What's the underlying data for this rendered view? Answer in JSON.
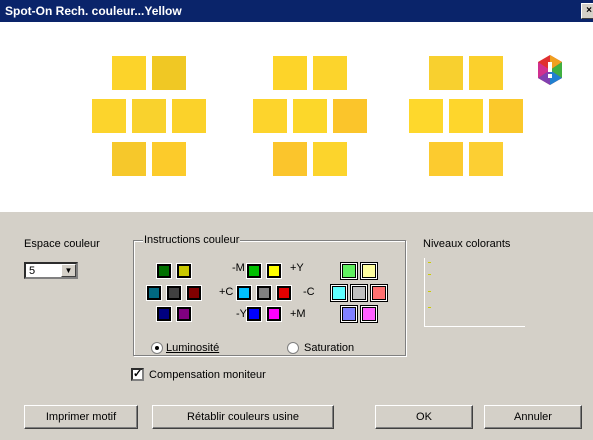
{
  "window": {
    "title": "Spot-On Rech. couleur...Yellow",
    "close_glyph": "×"
  },
  "preview": {
    "groups": [
      [
        "#fcd32a",
        "#f0c824",
        "#fcd42c",
        "#f9d22d",
        "#fbd22a",
        "#f6c82b",
        "#fccb2b",
        "#fcd534"
      ],
      [
        "#fdd429",
        "#fcd42c",
        "#fdd42c",
        "#fcd72a",
        "#fbc52b",
        "#fbc52c",
        "#fcd42c",
        "#fdcc29"
      ],
      [
        "#f8d02f",
        "#fbd02c",
        "#fed82c",
        "#fed62c",
        "#fbc92b",
        "#fccb2f",
        "#fccf33",
        "#fccd2c"
      ]
    ],
    "logo_icon": "color-wheel-icon"
  },
  "color_space": {
    "label": "Espace couleur",
    "value": "5"
  },
  "instructions": {
    "legend": "Instructions couleur",
    "signs": {
      "minus_m": "-M",
      "plus_y": "+Y",
      "plus_c": "+C",
      "minus_c": "-C",
      "minus_y": "-Y",
      "plus_m": "+M"
    },
    "swatches": {
      "left": [
        "#007000",
        "#c8c800",
        "#006880",
        "#404040",
        "#800000",
        "#000080",
        "#800080"
      ],
      "mid": [
        "#00c000",
        "#ffff00",
        "#00c0ff",
        "#808080",
        "#e00000",
        "#0000ff",
        "#ff00ff"
      ],
      "right": [
        "#60f060",
        "#ffffa0",
        "#60ffff",
        "#c0c0c0",
        "#ff7070",
        "#8080ff",
        "#ff60ff"
      ]
    },
    "radio_luminosity": "Luminosité",
    "radio_saturation": "Saturation"
  },
  "levels": {
    "label": "Niveaux colorants"
  },
  "monitor_compensation": {
    "label": "Compensation moniteur",
    "checked": true
  },
  "buttons": {
    "print": "Imprimer motif",
    "reset": "Rétablir couleurs usine",
    "ok": "OK",
    "cancel": "Annuler"
  }
}
